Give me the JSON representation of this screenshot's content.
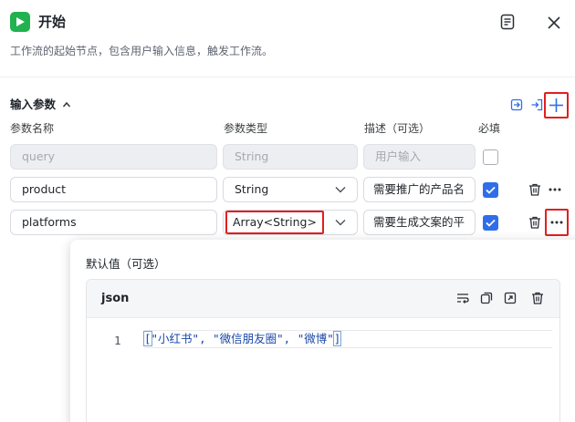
{
  "header": {
    "title": "开始",
    "description": "工作流的起始节点，包含用户输入信息，触发工作流。"
  },
  "section": {
    "title": "输入参数"
  },
  "columns": {
    "name": "参数名称",
    "type": "参数类型",
    "desc": "描述（可选）",
    "required": "必填"
  },
  "rows": [
    {
      "name": "query",
      "type": "String",
      "desc": "用户输入",
      "required": false,
      "disabled": true
    },
    {
      "name": "product",
      "type": "String",
      "desc": "需要推广的产品名",
      "required": true,
      "disabled": false
    },
    {
      "name": "platforms",
      "type": "Array<String>",
      "desc": "需要生成文案的平",
      "required": true,
      "disabled": false
    }
  ],
  "popover": {
    "label": "默认值（可选）",
    "editor_lang": "json",
    "line_number": "1",
    "code_open": "[",
    "code_body": "\"小红书\", \"微信朋友圈\", \"微博\"",
    "code_close": "]"
  },
  "colors": {
    "accent": "#2f6ee8",
    "start_icon": "#21b24f",
    "highlight_box": "#e02020",
    "code_string": "#1b48a8"
  },
  "icons": {
    "start": "play-icon",
    "doc": "document-icon",
    "close": "close-icon",
    "import": "import-icon",
    "export": "export-icon",
    "add": "plus-icon",
    "delete": "trash-icon",
    "more": "more-icon"
  }
}
